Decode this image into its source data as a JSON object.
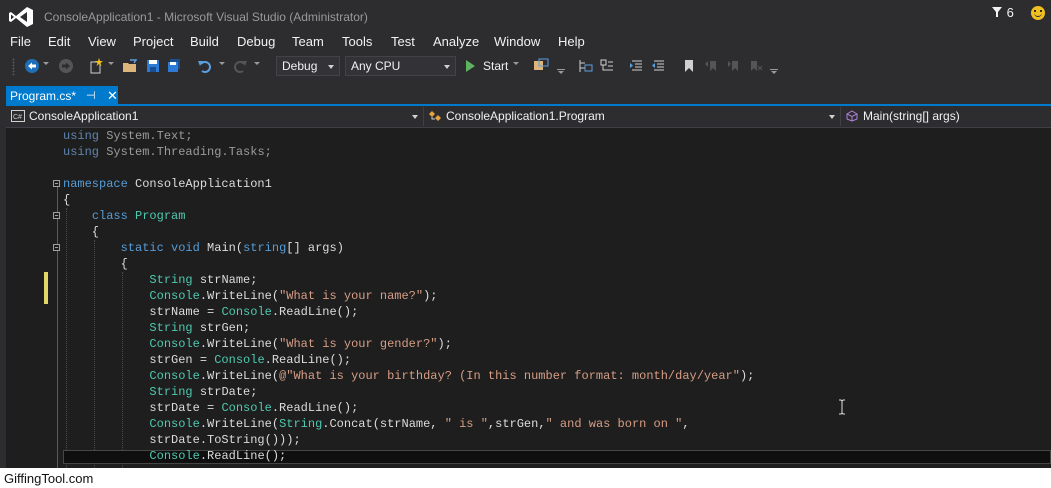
{
  "window": {
    "title": "ConsoleApplication1 - Microsoft Visual Studio (Administrator)",
    "notification_count": "6",
    "icons": [
      "visual-studio-logo-icon",
      "notification-flag-icon",
      "feedback-smiley-icon"
    ]
  },
  "menu": [
    "File",
    "Edit",
    "View",
    "Project",
    "Build",
    "Debug",
    "Team",
    "Tools",
    "Test",
    "Analyze",
    "Window",
    "Help"
  ],
  "toolbar": {
    "configuration": "Debug",
    "platform": "Any CPU",
    "start_label": "Start"
  },
  "tabs": [
    {
      "label": "Program.cs*",
      "pin": "⊣",
      "close": "✕",
      "active": true
    }
  ],
  "navbar": {
    "project": "ConsoleApplication1",
    "class": "ConsoleApplication1.Program",
    "member": "Main(string[] args)"
  },
  "code_lines": [
    [
      {
        "t": "using",
        "c": "dimkw"
      },
      {
        "t": " System.Text;",
        "c": "dim"
      }
    ],
    [
      {
        "t": "using",
        "c": "dimkw"
      },
      {
        "t": " System.Threading.Tasks;",
        "c": "dim"
      }
    ],
    [],
    [
      {
        "t": "namespace",
        "c": "kw"
      },
      {
        "t": " ConsoleApplication1"
      }
    ],
    [
      {
        "t": "{"
      }
    ],
    [
      {
        "t": "    "
      },
      {
        "t": "class",
        "c": "kw"
      },
      {
        "t": " "
      },
      {
        "t": "Program",
        "c": "ty"
      }
    ],
    [
      {
        "t": "    {"
      }
    ],
    [
      {
        "t": "        "
      },
      {
        "t": "static",
        "c": "kw"
      },
      {
        "t": " "
      },
      {
        "t": "void",
        "c": "kw"
      },
      {
        "t": " Main("
      },
      {
        "t": "string",
        "c": "kw"
      },
      {
        "t": "[] args)"
      }
    ],
    [
      {
        "t": "        {"
      }
    ],
    [
      {
        "t": "            "
      },
      {
        "t": "String",
        "c": "ty"
      },
      {
        "t": " strName;"
      }
    ],
    [
      {
        "t": "            "
      },
      {
        "t": "Console",
        "c": "ty"
      },
      {
        "t": ".WriteLine("
      },
      {
        "t": "\"What is your name?\"",
        "c": "st"
      },
      {
        "t": ");"
      }
    ],
    [
      {
        "t": "            strName = "
      },
      {
        "t": "Console",
        "c": "ty"
      },
      {
        "t": ".ReadLine();"
      }
    ],
    [
      {
        "t": "            "
      },
      {
        "t": "String",
        "c": "ty"
      },
      {
        "t": " strGen;"
      }
    ],
    [
      {
        "t": "            "
      },
      {
        "t": "Console",
        "c": "ty"
      },
      {
        "t": ".WriteLine("
      },
      {
        "t": "\"What is your gender?\"",
        "c": "st"
      },
      {
        "t": ");"
      }
    ],
    [
      {
        "t": "            strGen = "
      },
      {
        "t": "Console",
        "c": "ty"
      },
      {
        "t": ".ReadLine();"
      }
    ],
    [
      {
        "t": "            "
      },
      {
        "t": "Console",
        "c": "ty"
      },
      {
        "t": ".WriteLine("
      },
      {
        "t": "@\"What is your birthday? (In this number format: month/day/year\"",
        "c": "st"
      },
      {
        "t": ");"
      }
    ],
    [
      {
        "t": "            "
      },
      {
        "t": "String",
        "c": "ty"
      },
      {
        "t": " strDate;"
      }
    ],
    [
      {
        "t": "            strDate = "
      },
      {
        "t": "Console",
        "c": "ty"
      },
      {
        "t": ".ReadLine();"
      }
    ],
    [
      {
        "t": "            "
      },
      {
        "t": "Console",
        "c": "ty"
      },
      {
        "t": ".WriteLine("
      },
      {
        "t": "String",
        "c": "ty"
      },
      {
        "t": ".Concat(strName, "
      },
      {
        "t": "\" is \"",
        "c": "st"
      },
      {
        "t": ",strGen,"
      },
      {
        "t": "\" and was born on \"",
        "c": "st"
      },
      {
        "t": ","
      }
    ],
    [
      {
        "t": "            strDate.ToString()));"
      }
    ],
    [
      {
        "t": "            "
      },
      {
        "t": "Console",
        "c": "ty"
      },
      {
        "t": ".ReadLine();"
      }
    ]
  ],
  "watermark": "GiffingTool.com",
  "colors": {
    "accent": "#007acc",
    "chrome": "#2d2d30",
    "editor_bg": "#1e1e1e",
    "keyword": "#569cd6",
    "type": "#4ec9b0",
    "string": "#d69d85",
    "change_marker": "#e0d66a"
  }
}
